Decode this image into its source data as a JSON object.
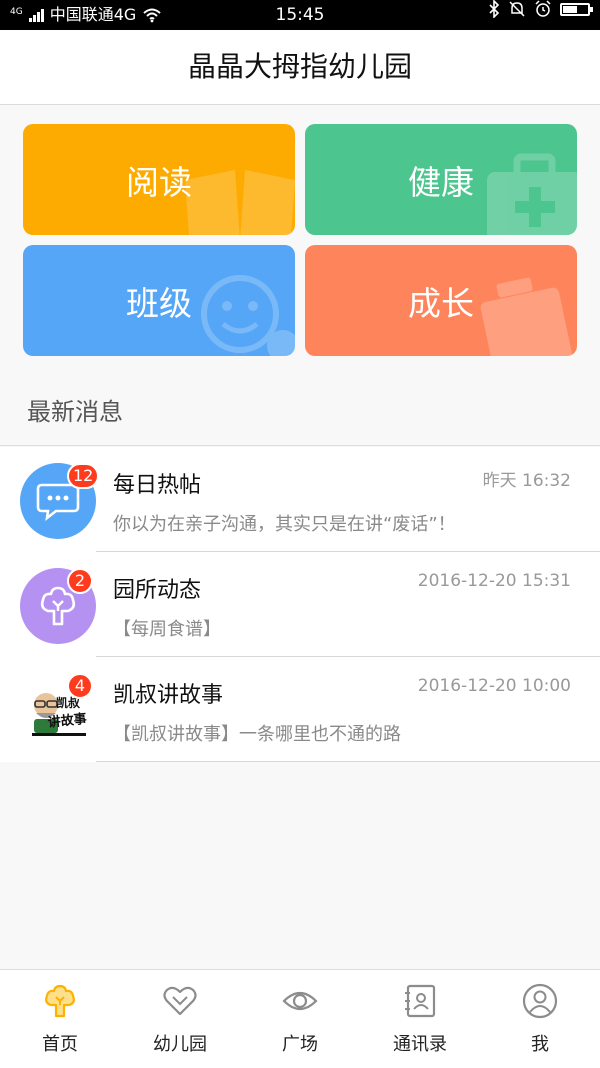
{
  "status_bar": {
    "network_small": "4G",
    "carrier": "中国联通4G",
    "time": "15:45"
  },
  "header": {
    "title": "晶晶大拇指幼儿园"
  },
  "tiles": [
    {
      "label": "阅读",
      "color": "#fdab00",
      "icon": "book-icon"
    },
    {
      "label": "健康",
      "color": "#4dc58f",
      "icon": "medical-kit-icon"
    },
    {
      "label": "班级",
      "color": "#55a6f6",
      "icon": "smiley-icon"
    },
    {
      "label": "成长",
      "color": "#fe845b",
      "icon": "document-icon"
    }
  ],
  "section": {
    "latest_title": "最新消息"
  },
  "messages": [
    {
      "title": "每日热帖",
      "time": "昨天 16:32",
      "preview": "你以为在亲子沟通，其实只是在讲“废话”！",
      "badge": "12",
      "avatar_color": "#55a6f6",
      "icon": "chat-bubble-icon"
    },
    {
      "title": "园所动态",
      "time": "2016-12-20 15:31",
      "preview": "【每周食谱】",
      "badge": "2",
      "avatar_color": "#b592f1",
      "icon": "tree-icon"
    },
    {
      "title": "凯叔讲故事",
      "time": "2016-12-20 10:00",
      "preview": "【凯叔讲故事】一条哪里也不通的路",
      "badge": "4",
      "avatar_color": "#ffffff",
      "icon": "storyteller-logo-icon"
    }
  ],
  "tabbar": {
    "items": [
      {
        "label": "首页",
        "icon": "home-tree-icon",
        "active": true
      },
      {
        "label": "幼儿园",
        "icon": "heart-icon",
        "active": false
      },
      {
        "label": "广场",
        "icon": "eye-icon",
        "active": false
      },
      {
        "label": "通讯录",
        "icon": "contacts-icon",
        "active": false
      },
      {
        "label": "我",
        "icon": "profile-icon",
        "active": false
      }
    ],
    "active_color": "#fdb100",
    "inactive_color": "#8c8c8c"
  }
}
